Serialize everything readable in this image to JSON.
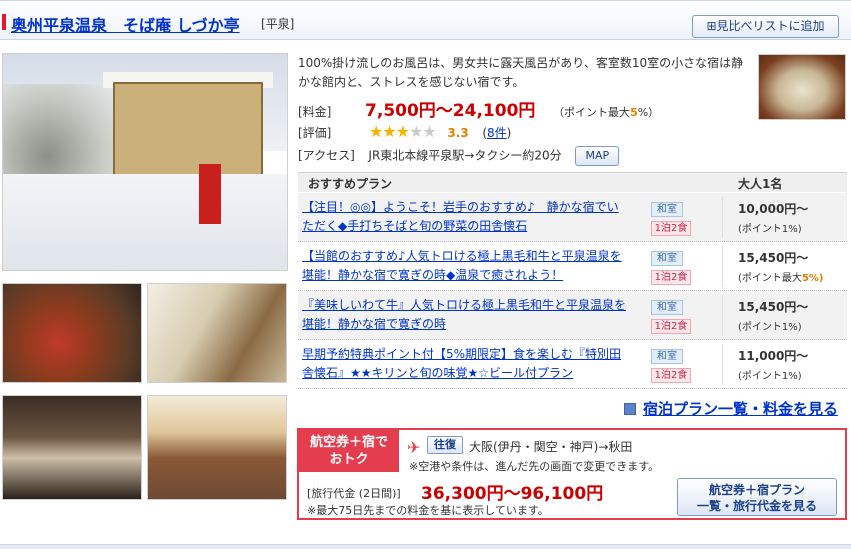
{
  "header": {
    "title": "奥州平泉温泉　そば庵 しづか亭",
    "area": "[平泉]",
    "compare_button": "⊞見比べリストに追加"
  },
  "info": {
    "description": "100%掛け流しのお風呂は、男女共に露天風呂があり、客室数10室の小さな宿は静かな館内と、ストレスを感じない宿です。",
    "price_label": "[料金]",
    "price": "7,500円〜24,100円",
    "price_point": "（ポイント最大",
    "price_point_pct": "5",
    "price_point_end": "%）",
    "rating_label": "[評価]",
    "rating_value": 3,
    "rating_max": 5,
    "rating_score": "3.3",
    "rating_count": "8件",
    "access_label": "[アクセス]",
    "access": "JR東北本線平泉駅→タクシー約20分",
    "map_button": "MAP"
  },
  "plans": {
    "header_plan": "おすすめプラン",
    "header_price": "大人1名",
    "items": [
      {
        "name": "【注目！◎◎】ようこそ！岩手のおすすめ♪　静かな宿でいただく◆手打ちそばと旬の野菜の田舎懐石",
        "room": "和室",
        "meal": "1泊2食",
        "price": "10,000円〜",
        "point": "(ポイント1%)",
        "point_pct": ""
      },
      {
        "name": "【当館のおすすめ♪人気トロける極上黒毛和牛と平泉温泉を堪能！静かな宿で寛ぎの時◆温泉で癒されよう！",
        "room": "和室",
        "meal": "1泊2食",
        "price": "15,450円〜",
        "point": "(ポイント最大",
        "point_pct": "5%)"
      },
      {
        "name": "『美味しいわて牛』人気トロける極上黒毛和牛と平泉温泉を堪能！静かな宿で寛ぎの時",
        "room": "和室",
        "meal": "1泊2食",
        "price": "15,450円〜",
        "point": "(ポイント1%)",
        "point_pct": ""
      },
      {
        "name": "早期予約特典ポイント付【5%期限定】食を楽しむ『特別田舎懐石』★★キリンと旬の味覚★☆ビール付プラン",
        "room": "和室",
        "meal": "1泊2食",
        "price": "11,000円〜",
        "point": "(ポイント1%)",
        "point_pct": ""
      }
    ],
    "all_link": "宿泊プラン一覧・料金を見る"
  },
  "airhotel": {
    "badge_line1": "航空券＋宿で",
    "badge_line2": "おトク",
    "plane_icon": "✈",
    "roundtrip": "往復",
    "route": "大阪(伊丹・関空・神戸)→秋田",
    "note1": "※空港や条件は、進んだ先の画面で変更できます。",
    "cost_label": "[旅行代金 (2日間)]",
    "cost_value": "36,300円〜96,100円",
    "note2": "※最大75日先までの料金を基に表示しています。",
    "button_line1": "航空券＋宿プラン",
    "button_line2": "一覧・旅行代金を見る"
  },
  "colors": {
    "accent_red": "#e33d4e",
    "link_blue": "#0033cc",
    "price_red": "#cc0000",
    "star_gold": "#f5b400"
  }
}
